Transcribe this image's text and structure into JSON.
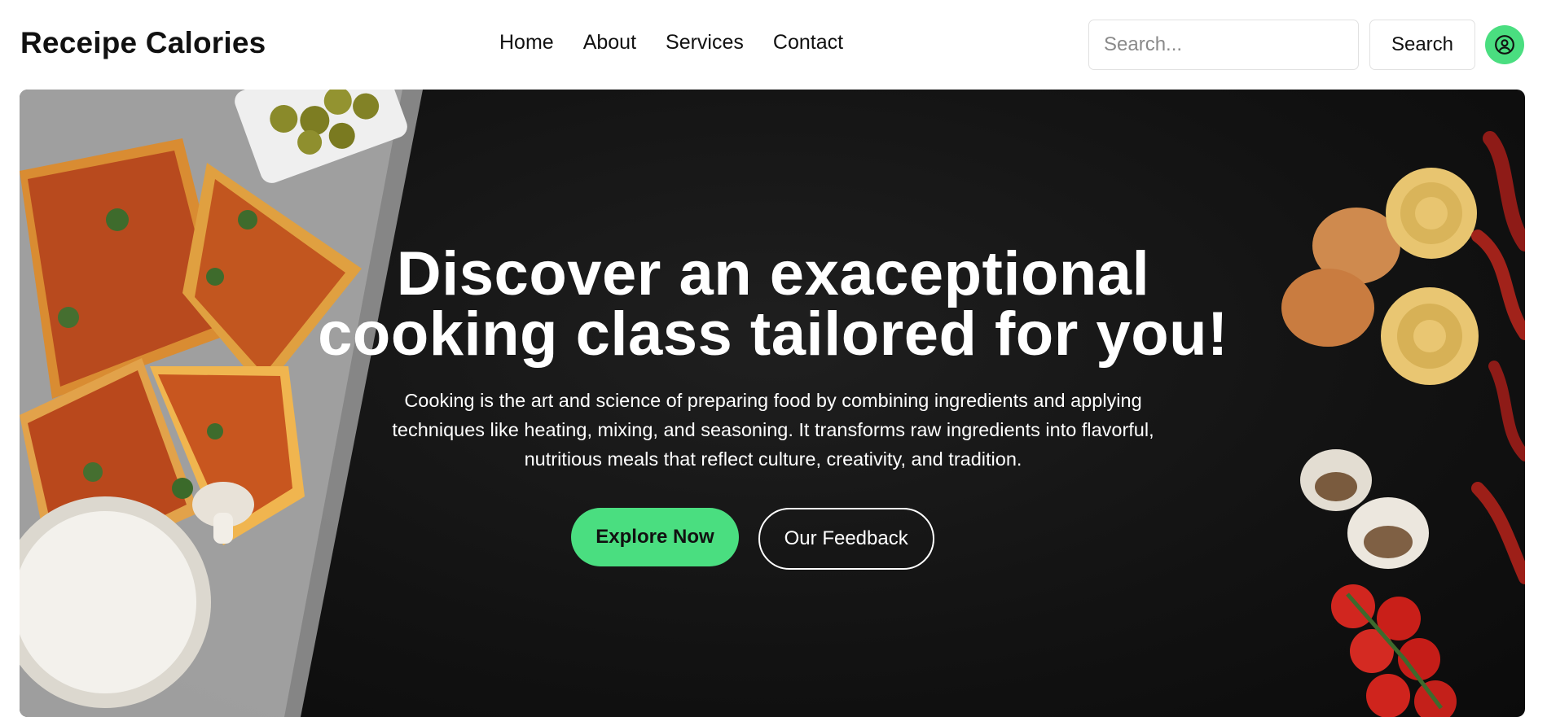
{
  "header": {
    "brand": "Receipe Calories",
    "nav": [
      "Home",
      "About",
      "Services",
      "Contact"
    ],
    "search_placeholder": "Search...",
    "search_button": "Search",
    "user_icon": "user-circle-icon"
  },
  "hero": {
    "title_line1": "Discover an exaceptional",
    "title_line2": "cooking class tailored for you!",
    "description_line1": "Cooking is the art and science of preparing food by combining ingredients and applying",
    "description_line2": "techniques like heating, mixing, and seasoning. It transforms raw ingredients into flavorful,",
    "description_line3": "nutritious meals that reflect culture, creativity, and tradition.",
    "explore_button": "Explore Now",
    "feedback_button": "Our Feedback"
  },
  "colors": {
    "accent": "#4ade80",
    "hero_bg": "#121212",
    "text_dark": "#111111",
    "text_light": "#ffffff"
  }
}
